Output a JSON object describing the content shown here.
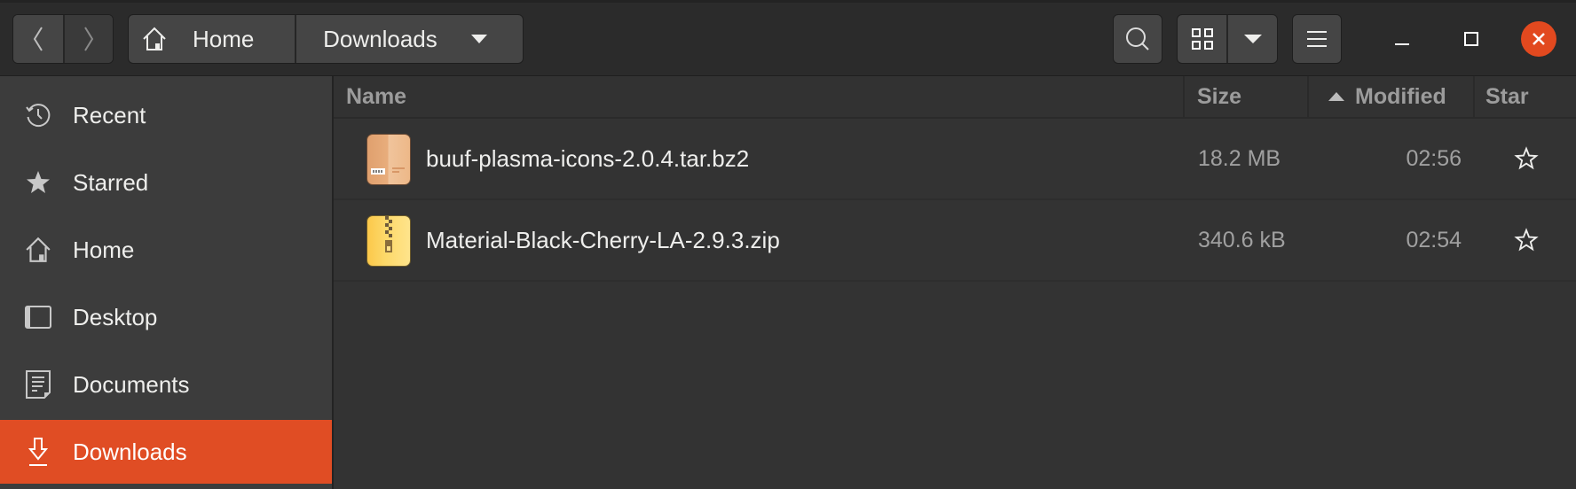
{
  "window": {
    "title": "Downloads",
    "controls": {
      "minimize_icon": "minimize-icon",
      "maximize_icon": "maximize-icon",
      "close_icon": "close-icon",
      "close_color": "#e2491f"
    }
  },
  "headerbar": {
    "nav": {
      "back_icon": "chevron-left-icon",
      "forward_icon": "chevron-right-icon"
    },
    "path": [
      {
        "label": "Home",
        "icon": "home-icon"
      },
      {
        "label": "Downloads",
        "icon": "caret-down-icon"
      }
    ],
    "tools": {
      "search_icon": "search-icon",
      "view_icon": "grid-view-icon",
      "view_options_icon": "caret-down-icon",
      "menu_icon": "hamburger-menu-icon"
    }
  },
  "sidebar": {
    "accent": "#e04d24",
    "items": [
      {
        "label": "Recent",
        "icon": "clock-icon",
        "active": false
      },
      {
        "label": "Starred",
        "icon": "star-icon",
        "active": false
      },
      {
        "label": "Home",
        "icon": "home-icon",
        "active": false
      },
      {
        "label": "Desktop",
        "icon": "desktop-icon",
        "active": false
      },
      {
        "label": "Documents",
        "icon": "document-icon",
        "active": false
      },
      {
        "label": "Downloads",
        "icon": "download-icon",
        "active": true
      }
    ]
  },
  "files": {
    "columns": [
      {
        "label": "Name"
      },
      {
        "label": "Size"
      },
      {
        "label": "Modified",
        "sort": "ascending"
      },
      {
        "label": "Star"
      }
    ],
    "rows": [
      {
        "name": "buuf-plasma-icons-2.0.4.tar.bz2",
        "size": "18.2 MB",
        "modified": "02:56",
        "icon": "archive-tar-icon",
        "starred": false
      },
      {
        "name": "Material-Black-Cherry-LA-2.9.3.zip",
        "size": "340.6 kB",
        "modified": "02:54",
        "icon": "archive-zip-icon",
        "starred": false
      }
    ]
  }
}
